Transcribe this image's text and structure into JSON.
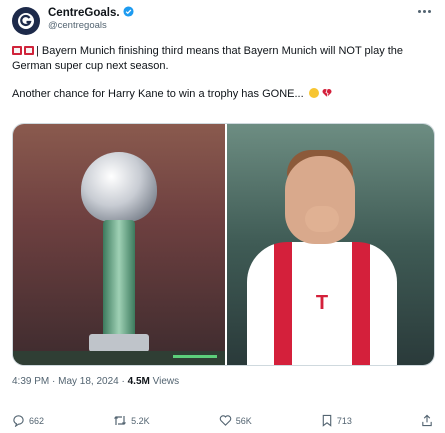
{
  "author": {
    "display_name": "CentreGoals.",
    "handle": "@centregoals",
    "avatar_letter": "G"
  },
  "tweet": {
    "line1": "| Bayern Munich finishing third means that Bayern Munich will NOT play the German super cup next season.",
    "line2": "Another chance for Harry Kane to win a trophy has GONE..."
  },
  "meta": {
    "time": "4:39 PM · May 18, 2024 · ",
    "views_count": "4.5M",
    "views_label": " Views"
  },
  "actions": {
    "replies": "662",
    "reposts": "5.2K",
    "likes": "56K",
    "bookmarks": "713"
  },
  "colors": {
    "brand_red": "#d4203b",
    "verified_blue": "#1d9bf0",
    "muted": "#536471"
  }
}
